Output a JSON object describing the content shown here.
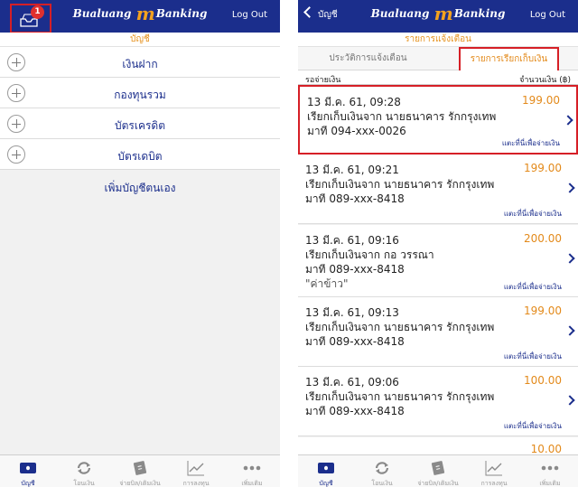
{
  "left_screen": {
    "header": {
      "logo_prefix": "Bualuang",
      "logo_m": "m",
      "logo_suffix": "Banking",
      "logout": "Log Out",
      "badge_count": "1"
    },
    "section_title": "บัญชี",
    "accounts": [
      {
        "label": "เงินฝาก"
      },
      {
        "label": "กองทุนรวม"
      },
      {
        "label": "บัตรเครดิต"
      },
      {
        "label": "บัตรเดบิต"
      }
    ],
    "add_account": "เพิ่มบัญชีตนเอง"
  },
  "right_screen": {
    "header": {
      "back_label": "บัญชี",
      "logo_prefix": "Bualuang",
      "logo_m": "m",
      "logo_suffix": "Banking",
      "logout": "Log Out"
    },
    "section_title": "รายการแจ้งเตือน",
    "tabs": [
      {
        "label": "ประวัติการแจ้งเตือน",
        "active": false
      },
      {
        "label": "รายการเรียกเก็บเงิน",
        "active": true
      }
    ],
    "column_left": "รอจ่ายเงิน",
    "column_right": "จำนวนเงิน (฿)",
    "pay_link": "แตะที่นี่เพื่อจ่ายเงิน",
    "items": [
      {
        "date": "13 มี.ค. 61, 09:28",
        "amount": "199.00",
        "desc": "เรียกเก็บเงินจาก นายธนาคาร รักกรุงเทพ",
        "phone": "มาที 094-xxx-0026",
        "note": ""
      },
      {
        "date": "13 มี.ค. 61, 09:21",
        "amount": "199.00",
        "desc": "เรียกเก็บเงินจาก นายธนาคาร รักกรุงเทพ",
        "phone": "มาที 089-xxx-8418",
        "note": ""
      },
      {
        "date": "13 มี.ค. 61, 09:16",
        "amount": "200.00",
        "desc": "เรียกเก็บเงินจาก กอ วรรณา",
        "phone": "มาที 089-xxx-8418",
        "note": "\"ค่าข้าว\""
      },
      {
        "date": "13 มี.ค. 61, 09:13",
        "amount": "199.00",
        "desc": "เรียกเก็บเงินจาก นายธนาคาร รักกรุงเทพ",
        "phone": "มาที 089-xxx-8418",
        "note": ""
      },
      {
        "date": "13 มี.ค. 61, 09:06",
        "amount": "100.00",
        "desc": "เรียกเก็บเงินจาก นายธนาคาร รักกรุงเทพ",
        "phone": "มาที 089-xxx-8418",
        "note": ""
      }
    ],
    "partial_amount": "10.00"
  },
  "tabbar": [
    {
      "label": "บัญชี",
      "icon": "bank-card-icon",
      "active": true
    },
    {
      "label": "โอนเงิน",
      "icon": "transfer-icon",
      "active": false
    },
    {
      "label": "จ่ายบิล/เติมเงิน",
      "icon": "bill-icon",
      "active": false
    },
    {
      "label": "การลงทุน",
      "icon": "chart-icon",
      "active": false
    },
    {
      "label": "เพิ่มเติม",
      "icon": "more-icon",
      "active": false
    }
  ],
  "colors": {
    "brand_blue": "#1b2e8c",
    "accent_orange": "#e38a1b",
    "highlight_red": "#d61f26"
  }
}
